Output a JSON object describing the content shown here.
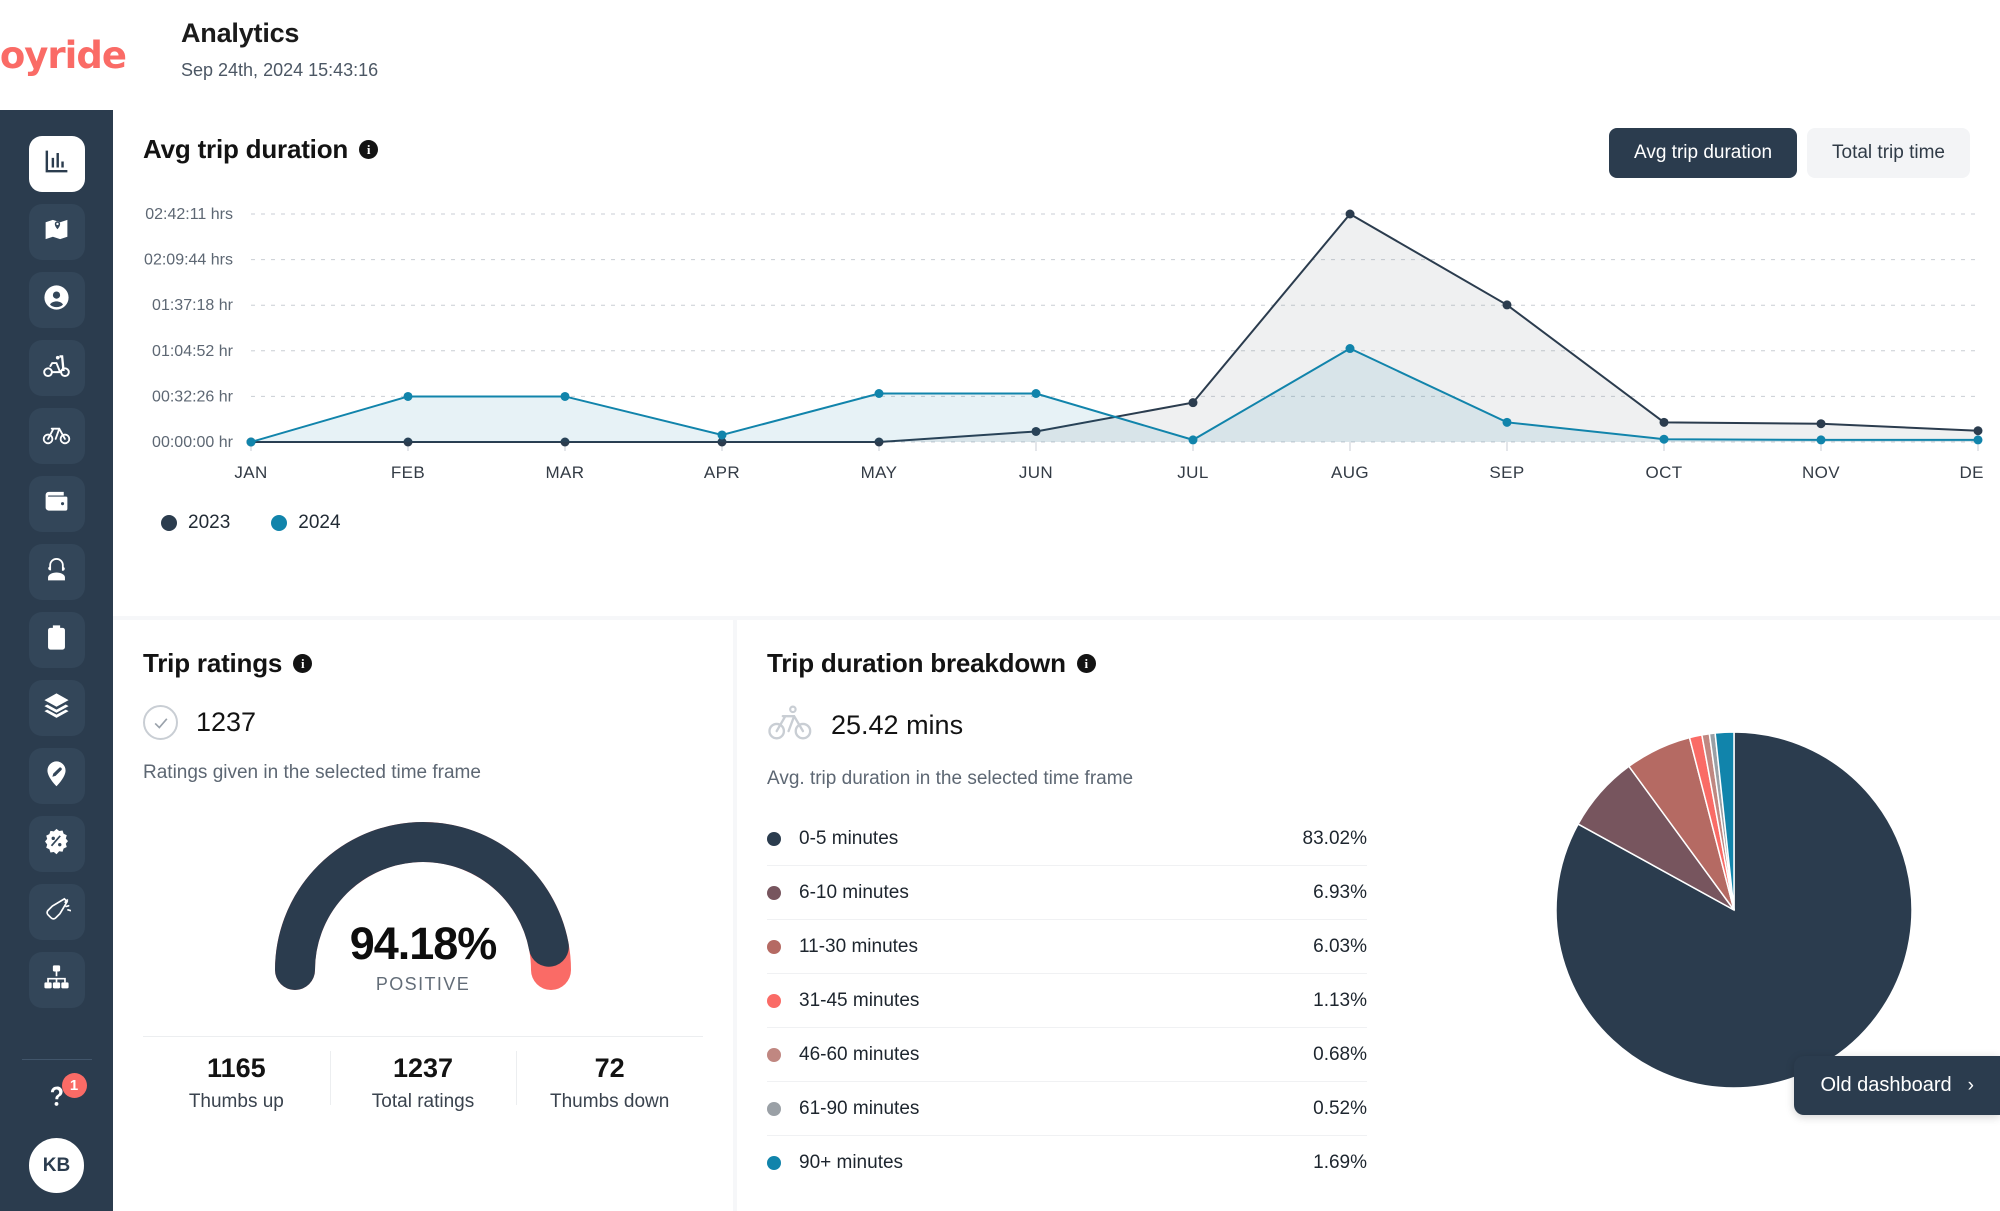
{
  "brand": {
    "name": "Joyride"
  },
  "header": {
    "title": "Analytics",
    "timestamp": "Sep 24th, 2024 15:43:16"
  },
  "sidebar": {
    "items": [
      {
        "icon": "bar-chart-icon",
        "name": "analytics",
        "active": true
      },
      {
        "icon": "map-icon",
        "name": "map",
        "active": false
      },
      {
        "icon": "user-icon",
        "name": "users",
        "active": false
      },
      {
        "icon": "scooter-icon",
        "name": "scooters",
        "active": false
      },
      {
        "icon": "bicycle-icon",
        "name": "bikes",
        "active": false
      },
      {
        "icon": "wallet-icon",
        "name": "payments",
        "active": false
      },
      {
        "icon": "support-agent-icon",
        "name": "support",
        "active": false
      },
      {
        "icon": "clipboard-tasks-icon",
        "name": "tasks",
        "active": false
      },
      {
        "icon": "layers-icon",
        "name": "fleets",
        "active": false
      },
      {
        "icon": "map-pin-tag-icon",
        "name": "zones",
        "active": false
      },
      {
        "icon": "discount-badge-icon",
        "name": "promotions",
        "active": false
      },
      {
        "icon": "megaphone-icon",
        "name": "marketing",
        "active": false
      },
      {
        "icon": "org-chart-icon",
        "name": "organization",
        "active": false
      }
    ],
    "help": {
      "icon": "help-question-icon",
      "badge": "1"
    },
    "avatar": {
      "initials": "KB"
    }
  },
  "chart_card": {
    "title": "Avg trip duration",
    "info_glyph": "i",
    "toggles": [
      {
        "label": "Avg trip duration",
        "active": true
      },
      {
        "label": "Total trip time",
        "active": false
      }
    ]
  },
  "chart_data": {
    "type": "line",
    "title": "Avg trip duration",
    "xlabel": "",
    "ylabel": "",
    "grid": true,
    "legend_position": "bottom-left",
    "categories": [
      "JAN",
      "FEB",
      "MAR",
      "APR",
      "MAY",
      "JUN",
      "JUL",
      "AUG",
      "SEP",
      "OCT",
      "NOV",
      "DEC"
    ],
    "ytick_labels": [
      "00:00:00 hr",
      "00:32:26 hr",
      "01:04:52 hr",
      "01:37:18 hr",
      "02:09:44 hrs",
      "02:42:11 hrs"
    ],
    "ytick_values": [
      0,
      32.44,
      64.87,
      97.3,
      129.73,
      162.18
    ],
    "ylim": [
      0,
      162.18
    ],
    "yunit": "minutes",
    "series": [
      {
        "name": "2023",
        "color": "#2b3c4e",
        "values": [
          0,
          0,
          0,
          0,
          0,
          7.5,
          28,
          162.18,
          97.5,
          14,
          13,
          8
        ]
      },
      {
        "name": "2024",
        "color": "#1184ab",
        "values": [
          0,
          32.4,
          32.4,
          5,
          34.5,
          34.5,
          1.5,
          66.5,
          14,
          2,
          1.5,
          1.5
        ]
      }
    ]
  },
  "ratings_card": {
    "title": "Trip ratings",
    "info_glyph": "i",
    "metric_value": "1237",
    "metric_caption": "Ratings given in the selected time frame",
    "gauge": {
      "percent_label": "94.18%",
      "percent_value": 94.18,
      "sub_label": "POSITIVE",
      "positive_color": "#2b3c4e",
      "negative_color": "#fa6b66"
    },
    "stats": [
      {
        "value": "1165",
        "label": "Thumbs up"
      },
      {
        "value": "1237",
        "label": "Total ratings"
      },
      {
        "value": "72",
        "label": "Thumbs down"
      }
    ]
  },
  "breakdown_card": {
    "title": "Trip duration breakdown",
    "info_glyph": "i",
    "metric_value": "25.42 mins",
    "metric_caption": "Avg. trip duration in the selected time frame",
    "icon": "bicycle-icon",
    "pie": {
      "type": "pie",
      "slices": [
        {
          "label": "0-5 minutes",
          "value": 83.02,
          "color": "#2b3c4e"
        },
        {
          "label": "6-10 minutes",
          "value": 6.93,
          "color": "#77555e"
        },
        {
          "label": "11-30 minutes",
          "value": 6.03,
          "color": "#b56a63"
        },
        {
          "label": "31-45 minutes",
          "value": 1.13,
          "color": "#fa6b66"
        },
        {
          "label": "46-60 minutes",
          "value": 0.68,
          "color": "#c08781"
        },
        {
          "label": "61-90 minutes",
          "value": 0.52,
          "color": "#9aa0a6"
        },
        {
          "label": "90+ minutes",
          "value": 1.69,
          "color": "#1184ab"
        }
      ]
    },
    "rows": [
      {
        "label": "0-5 minutes",
        "pct": "83.02%",
        "color": "#2b3c4e"
      },
      {
        "label": "6-10 minutes",
        "pct": "6.93%",
        "color": "#77555e"
      },
      {
        "label": "11-30 minutes",
        "pct": "6.03%",
        "color": "#b56a63"
      },
      {
        "label": "31-45 minutes",
        "pct": "1.13%",
        "color": "#fa6b66"
      },
      {
        "label": "46-60 minutes",
        "pct": "0.68%",
        "color": "#c08781"
      },
      {
        "label": "61-90 minutes",
        "pct": "0.52%",
        "color": "#9aa0a6"
      },
      {
        "label": "90+ minutes",
        "pct": "1.69%",
        "color": "#1184ab"
      }
    ]
  },
  "old_dashboard": {
    "label": "Old dashboard",
    "chevron": "›"
  }
}
